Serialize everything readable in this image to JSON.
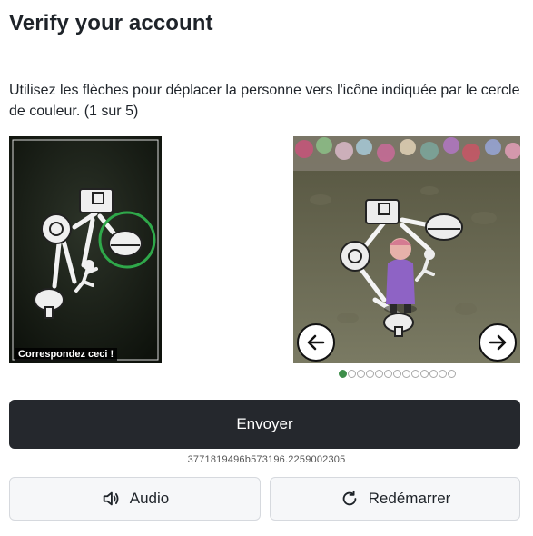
{
  "header": {
    "title": "Verify your account"
  },
  "instructions": "Utilisez les flèches pour déplacer la personne vers l'icône indiquée par le cercle de couleur. (1 sur 5)",
  "reference": {
    "caption": "Correspondez ceci !"
  },
  "carousel": {
    "total_dots": 13,
    "active_index": 0
  },
  "buttons": {
    "submit_label": "Envoyer",
    "audio_label": "Audio",
    "restart_label": "Redémarrer"
  },
  "session_id": "3771819496b573196.2259002305",
  "icons": {
    "left": "arrow-left-icon",
    "right": "arrow-right-icon",
    "audio": "speaker-icon",
    "restart": "refresh-icon"
  },
  "colors": {
    "target_circle": "#2fa84a",
    "submit_bg": "#25282d",
    "active_dot": "#3e8e4a"
  }
}
